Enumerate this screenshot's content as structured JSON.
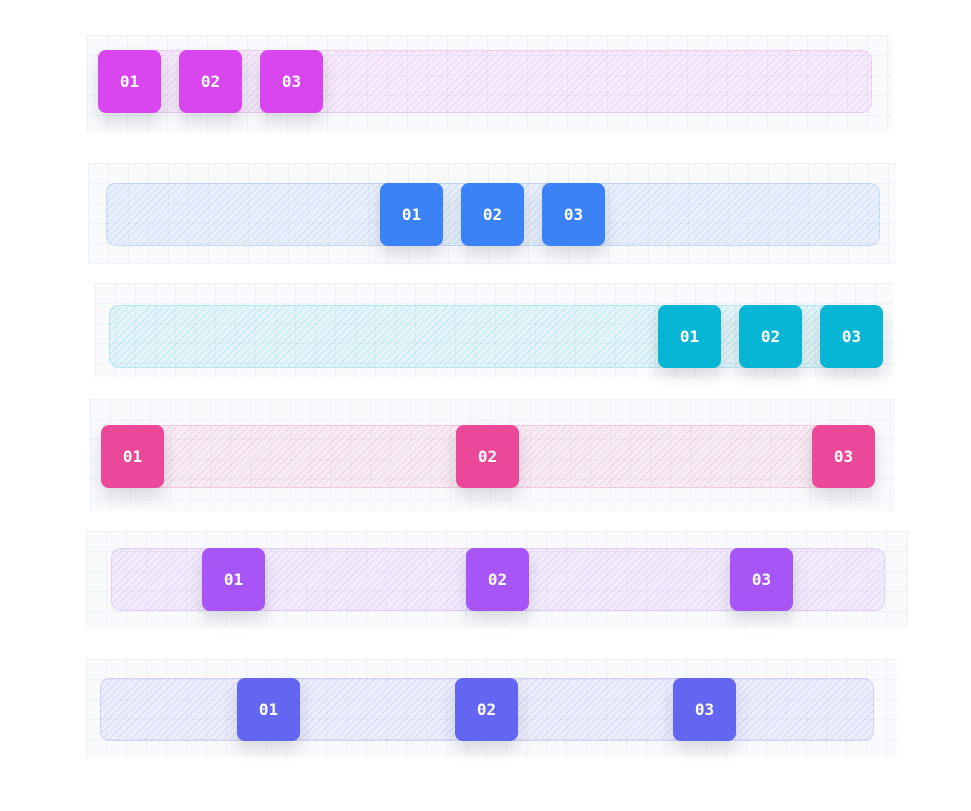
{
  "rows": [
    {
      "color": "#d946ef",
      "items": [
        "01",
        "02",
        "03"
      ]
    },
    {
      "color": "#3b82f6",
      "items": [
        "01",
        "02",
        "03"
      ]
    },
    {
      "color": "#06b6d4",
      "items": [
        "01",
        "02",
        "03"
      ]
    },
    {
      "color": "#ec4899",
      "items": [
        "01",
        "02",
        "03"
      ]
    },
    {
      "color": "#a855f7",
      "items": [
        "01",
        "02",
        "03"
      ]
    },
    {
      "color": "#6366f1",
      "items": [
        "01",
        "02",
        "03"
      ]
    }
  ]
}
